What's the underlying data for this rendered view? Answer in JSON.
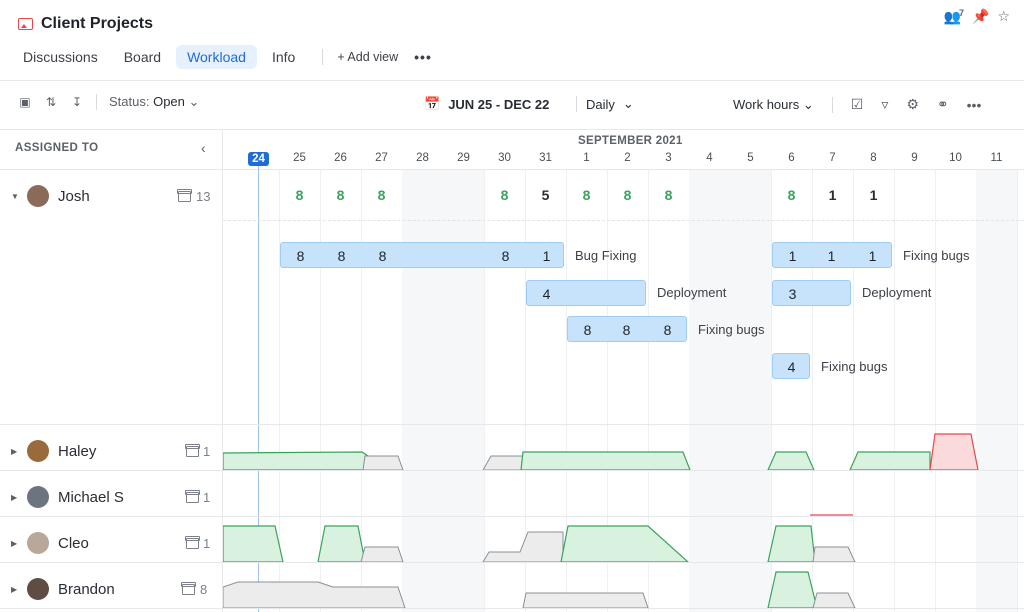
{
  "app": {
    "title": "Client Projects",
    "watchers_count": "7"
  },
  "tabs": [
    {
      "label": "Discussions",
      "active": false
    },
    {
      "label": "Board",
      "active": false
    },
    {
      "label": "Workload",
      "active": true
    },
    {
      "label": "Info",
      "active": false
    }
  ],
  "add_view_label": "Add view",
  "toolbar": {
    "status_label": "Status:",
    "status_value": "Open",
    "date_range": "JUN 25 - DEC 22",
    "scale": "Daily",
    "measure": "Work hours"
  },
  "panel": {
    "assigned_to_label": "ASSIGNED TO"
  },
  "timeline": {
    "month_label": "SEPTEMBER 2021",
    "days": [
      "24",
      "25",
      "26",
      "27",
      "28",
      "29",
      "30",
      "31",
      "1",
      "2",
      "3",
      "4",
      "5",
      "6",
      "7",
      "8",
      "9",
      "10",
      "11"
    ],
    "today": "24"
  },
  "people": [
    {
      "name": "Josh",
      "count": "13",
      "expanded": true
    },
    {
      "name": "Haley",
      "count": "1",
      "expanded": false
    },
    {
      "name": "Michael S",
      "count": "1",
      "expanded": false
    },
    {
      "name": "Cleo",
      "count": "1",
      "expanded": false
    },
    {
      "name": "Brandon",
      "count": "8",
      "expanded": false
    }
  ],
  "josh_summary": [
    "",
    "8",
    "8",
    "8",
    "",
    "",
    "8",
    "5",
    "8",
    "8",
    "8",
    "",
    "",
    "8",
    "1",
    "1",
    "",
    "",
    ""
  ],
  "tasks": [
    {
      "label": "Bug Fixing",
      "values": [
        "8",
        "8",
        "8",
        "",
        "",
        "8",
        "1"
      ]
    },
    {
      "label": "Fixing bugs",
      "values": [
        "1",
        "1",
        "1"
      ]
    },
    {
      "label": "Deployment",
      "values": [
        "4"
      ]
    },
    {
      "label": "Deployment",
      "values": [
        "3"
      ]
    },
    {
      "label": "Fixing bugs",
      "values": [
        "8",
        "8",
        "8"
      ]
    },
    {
      "label": "Fixing bugs",
      "values": [
        "4"
      ]
    }
  ],
  "colors": {
    "accent": "#1f6bd8",
    "under": "#3aa35c",
    "over": "#e5484d",
    "bar": "#c7e3fb"
  }
}
